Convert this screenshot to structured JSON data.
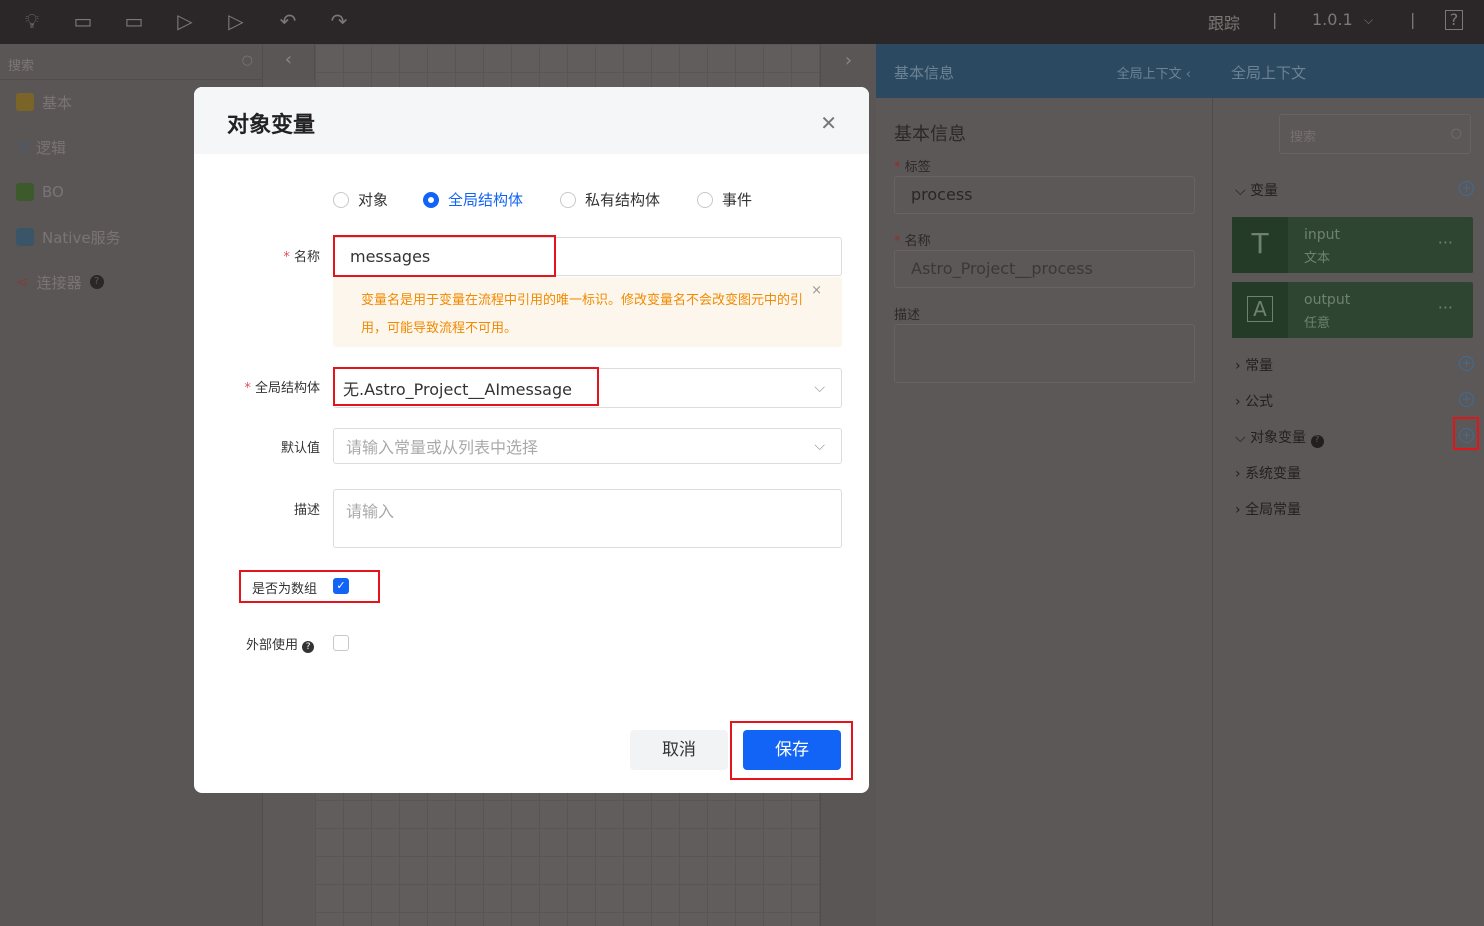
{
  "topbar": {
    "trace": "跟踪",
    "version": "1.0.1",
    "sep": "|"
  },
  "left": {
    "search_placeholder": "搜索",
    "items": [
      {
        "label": "基本"
      },
      {
        "label": "逻辑"
      },
      {
        "label": "BO"
      },
      {
        "label": "Native服务"
      },
      {
        "label": "连接器"
      }
    ]
  },
  "basic": {
    "header": "基本信息",
    "header_right": "全局上下文",
    "title": "基本信息",
    "label_label": "标签",
    "label_value": "process",
    "name_label": "名称",
    "name_value": "Astro_Project__process",
    "desc_label": "描述"
  },
  "ctx": {
    "header": "全局上下文",
    "search_placeholder": "搜索",
    "variables": "变量",
    "cards": [
      {
        "name": "input",
        "type": "文本",
        "icon": "T"
      },
      {
        "name": "output",
        "type": "任意",
        "icon": "A"
      }
    ],
    "constants": "常量",
    "formulas": "公式",
    "object_vars": "对象变量",
    "system_vars": "系统变量",
    "global_consts": "全局常量"
  },
  "modal": {
    "title": "对象变量",
    "radios": [
      "对象",
      "全局结构体",
      "私有结构体",
      "事件"
    ],
    "selected_radio": "全局结构体",
    "name_label": "名称",
    "name_value": "messages",
    "warning": "变量名是用于变量在流程中引用的唯一标识。修改变量名不会改变图元中的引用，可能导致流程不可用。",
    "struct_label": "全局结构体",
    "struct_value": "无.Astro_Project__AImessage",
    "default_label": "默认值",
    "default_placeholder": "请输入常量或从列表中选择",
    "desc_label": "描述",
    "desc_placeholder": "请输入",
    "is_array_label": "是否为数组",
    "is_array": true,
    "external_label": "外部使用",
    "external": false,
    "cancel": "取消",
    "save": "保存"
  }
}
